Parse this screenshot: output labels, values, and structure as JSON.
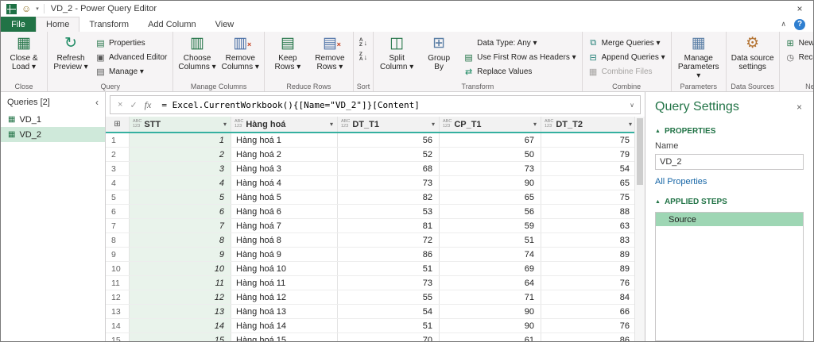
{
  "titlebar": {
    "title": "VD_2 - Power Query Editor",
    "smiley_icon": "☺",
    "qat_caret": "▾",
    "close_icon": "×"
  },
  "tabrow": {
    "file": "File",
    "tabs": [
      "Home",
      "Transform",
      "Add Column",
      "View"
    ],
    "active_tab": "Home",
    "collapse_icon": "∧",
    "help_icon": "?"
  },
  "ribbon": {
    "groups": [
      {
        "label": "Close",
        "items": [
          {
            "kind": "big",
            "name": "close-and-load",
            "icon": "▦",
            "color": "#217346",
            "l1": "Close &",
            "l2": "Load ▾"
          }
        ]
      },
      {
        "label": "Query",
        "items": [
          {
            "kind": "big",
            "name": "refresh-preview",
            "icon": "↻",
            "color": "#1d8a63",
            "l1": "Refresh",
            "l2": "Preview ▾"
          },
          {
            "kind": "stack",
            "children": [
              {
                "name": "properties",
                "icon": "▤",
                "color": "#217346",
                "label": "Properties"
              },
              {
                "name": "advanced-editor",
                "icon": "▣",
                "color": "#555555",
                "label": "Advanced Editor"
              },
              {
                "name": "manage",
                "icon": "▤",
                "color": "#555555",
                "label": "Manage ▾"
              }
            ]
          }
        ]
      },
      {
        "label": "Manage Columns",
        "items": [
          {
            "kind": "big",
            "name": "choose-columns",
            "icon": "▥",
            "color": "#217346",
            "l1": "Choose",
            "l2": "Columns ▾"
          },
          {
            "kind": "big",
            "name": "remove-columns",
            "icon": "▥",
            "color": "#4a6fa5",
            "overlay": "×",
            "overlay_color": "#c43e1c",
            "l1": "Remove",
            "l2": "Columns ▾"
          }
        ]
      },
      {
        "label": "Reduce Rows",
        "items": [
          {
            "kind": "big",
            "name": "keep-rows",
            "icon": "▤",
            "color": "#217346",
            "l1": "Keep",
            "l2": "Rows ▾"
          },
          {
            "kind": "big",
            "name": "remove-rows",
            "icon": "▤",
            "color": "#4a6fa5",
            "overlay": "×",
            "overlay_color": "#c43e1c",
            "l1": "Remove",
            "l2": "Rows ▾"
          }
        ]
      },
      {
        "label": "Sort",
        "items": [
          {
            "kind": "stack",
            "children": [
              {
                "name": "sort-ascending",
                "sort_letters": "AZ",
                "sort_arrow": "↓",
                "label": ""
              },
              {
                "name": "sort-descending",
                "sort_letters": "ZA",
                "sort_arrow": "↓",
                "label": ""
              }
            ]
          }
        ]
      },
      {
        "label": "Transform",
        "items": [
          {
            "kind": "big",
            "name": "split-column",
            "icon": "◫",
            "color": "#217346",
            "l1": "Split",
            "l2": "Column ▾"
          },
          {
            "kind": "big",
            "name": "group-by",
            "icon": "⊞",
            "color": "#5b7fa6",
            "l1": "Group",
            "l2": "By"
          },
          {
            "kind": "stack",
            "children": [
              {
                "name": "data-type",
                "icon": "",
                "label": "Data Type: Any ▾"
              },
              {
                "name": "use-first-row-as-headers",
                "icon": "▤",
                "color": "#217346",
                "label": "Use First Row as Headers ▾"
              },
              {
                "name": "replace-values",
                "icon": "⇄",
                "color": "#1d8a63",
                "label": "Replace Values"
              }
            ]
          }
        ]
      },
      {
        "label": "Combine",
        "items": [
          {
            "kind": "stack",
            "children": [
              {
                "name": "merge-queries",
                "icon": "⧉",
                "color": "#1d7d74",
                "label": "Merge Queries ▾"
              },
              {
                "name": "append-queries",
                "icon": "⊟",
                "color": "#1d7d74",
                "label": "Append Queries ▾"
              },
              {
                "name": "combine-files",
                "icon": "▦",
                "color": "#a6a4a2",
                "label": "Combine Files",
                "disabled": true
              }
            ]
          }
        ]
      },
      {
        "label": "Parameters",
        "items": [
          {
            "kind": "big",
            "name": "manage-parameters",
            "icon": "▦",
            "color": "#5b7fa6",
            "l1": "Manage",
            "l2": "Parameters ▾"
          }
        ]
      },
      {
        "label": "Data Sources",
        "items": [
          {
            "kind": "big",
            "name": "data-source-settings",
            "icon": "⚙",
            "color": "#b3712f",
            "l1": "Data source",
            "l2": "settings"
          }
        ]
      },
      {
        "label": "New Query",
        "items": [
          {
            "kind": "stack",
            "children": [
              {
                "name": "new-source",
                "icon": "⊞",
                "color": "#217346",
                "label": "New Source ▾"
              },
              {
                "name": "recent-sources",
                "icon": "◷",
                "color": "#555555",
                "label": "Recent Sources ▾"
              }
            ]
          }
        ]
      }
    ]
  },
  "queries_pane": {
    "header": "Queries [2]",
    "collapse_icon": "‹",
    "items": [
      {
        "label": "VD_1",
        "selected": false
      },
      {
        "label": "VD_2",
        "selected": true
      }
    ]
  },
  "formula_bar": {
    "cancel_icon": "×",
    "check_icon": "✓",
    "fx_icon": "fx",
    "formula": "= Excel.CurrentWorkbook(){[Name=\"VD_2\"]}[Content]",
    "expand_icon": "∨"
  },
  "grid": {
    "corner_icon": "⊞",
    "type_icon_top": "ABC",
    "type_icon_bottom": "123",
    "filter_icon": "▾",
    "columns": [
      {
        "name": "STT",
        "selected": true
      },
      {
        "name": "Hàng hoá",
        "selected": false
      },
      {
        "name": "DT_T1",
        "selected": false
      },
      {
        "name": "CP_T1",
        "selected": false
      },
      {
        "name": "DT_T2",
        "selected": false
      }
    ],
    "rows": [
      [
        1,
        "Hàng hoá 1",
        56,
        67,
        75
      ],
      [
        2,
        "Hàng hoá 2",
        52,
        50,
        79
      ],
      [
        3,
        "Hàng hoá 3",
        68,
        73,
        54
      ],
      [
        4,
        "Hàng hoá 4",
        73,
        90,
        65
      ],
      [
        5,
        "Hàng hoá 5",
        82,
        65,
        75
      ],
      [
        6,
        "Hàng hoá 6",
        53,
        56,
        88
      ],
      [
        7,
        "Hàng hoá 7",
        81,
        59,
        63
      ],
      [
        8,
        "Hàng hoá 8",
        72,
        51,
        83
      ],
      [
        9,
        "Hàng hoá 9",
        86,
        74,
        89
      ],
      [
        10,
        "Hàng hoá 10",
        51,
        69,
        89
      ],
      [
        11,
        "Hàng hoá 11",
        73,
        64,
        76
      ],
      [
        12,
        "Hàng hoá 12",
        55,
        71,
        84
      ],
      [
        13,
        "Hàng hoá 13",
        54,
        90,
        66
      ],
      [
        14,
        "Hàng hoá 14",
        51,
        90,
        76
      ],
      [
        15,
        "Hàng hoá 15",
        70,
        61,
        86
      ]
    ]
  },
  "query_settings": {
    "title": "Query Settings",
    "close_icon": "×",
    "properties_header": "PROPERTIES",
    "properties_triangle": "▲",
    "name_label": "Name",
    "name_value": "VD_2",
    "all_properties_link": "All Properties",
    "applied_steps_header": "APPLIED STEPS",
    "applied_steps_triangle": "▲",
    "steps": [
      {
        "label": "Source",
        "selected": true
      }
    ]
  },
  "colors": {
    "brand_green": "#217346",
    "grid_accent": "#35b0a0",
    "query_selection": "#cfe9da",
    "step_selection": "#9ed6b4"
  }
}
